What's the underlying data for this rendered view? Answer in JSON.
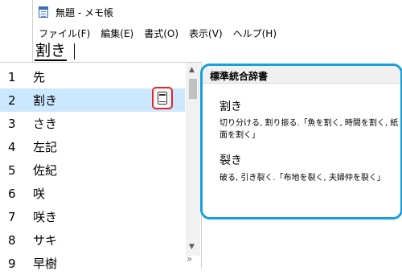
{
  "notepad": {
    "title": "無題 - メモ帳",
    "menu": [
      "ファイル(F)",
      "編集(E)",
      "書式(O)",
      "表示(V)",
      "ヘルプ(H)"
    ],
    "composing_text": "割き"
  },
  "candidates": {
    "items": [
      {
        "num": "1",
        "text": "先"
      },
      {
        "num": "2",
        "text": "割き"
      },
      {
        "num": "3",
        "text": "さき"
      },
      {
        "num": "4",
        "text": "左記"
      },
      {
        "num": "5",
        "text": "佐紀"
      },
      {
        "num": "6",
        "text": "咲"
      },
      {
        "num": "7",
        "text": "咲き"
      },
      {
        "num": "8",
        "text": "サキ"
      },
      {
        "num": "9",
        "text": "早樹"
      }
    ],
    "selected_index": 1,
    "expand_glyph": "»"
  },
  "dictionary": {
    "name": "標準統合辞書",
    "entries": [
      {
        "word": "割き",
        "definition": "切り分ける, 割り振る.「魚を割く, 時間を割く, 紙面を割く」"
      },
      {
        "word": "裂き",
        "definition": "破る, 引き裂く.「布地を裂く, 夫婦仲を裂く」"
      }
    ]
  },
  "colors": {
    "selection": "#cce8ff",
    "panel_border": "#1a9fdb",
    "highlight_box": "#e0262b"
  }
}
